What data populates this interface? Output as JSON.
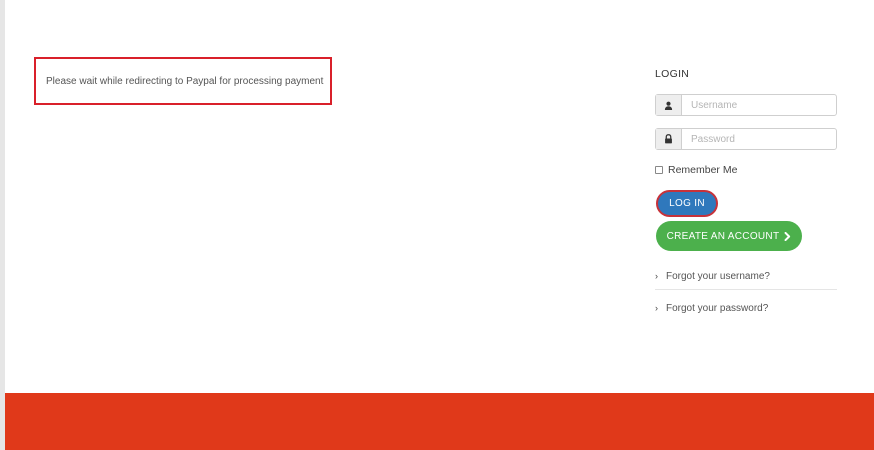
{
  "notice": {
    "text": "Please wait while redirecting to Paypal for processing payment"
  },
  "login": {
    "title": "LOGIN",
    "username_placeholder": "Username",
    "password_placeholder": "Password",
    "remember_label": "Remember Me",
    "login_button": "LOG IN",
    "create_button": "CREATE AN ACCOUNT",
    "links": [
      {
        "label": "Forgot your username?"
      },
      {
        "label": "Forgot your password?"
      }
    ]
  },
  "icons": {
    "username": "user-icon",
    "password": "lock-icon",
    "create": "chevron-right-icon",
    "link_arrow": "chevron-right-small-icon"
  },
  "colors": {
    "notice_border": "#d9202a",
    "login_button": "#2f78bc",
    "create_button": "#4cb04c",
    "footer": "#e0391a"
  }
}
